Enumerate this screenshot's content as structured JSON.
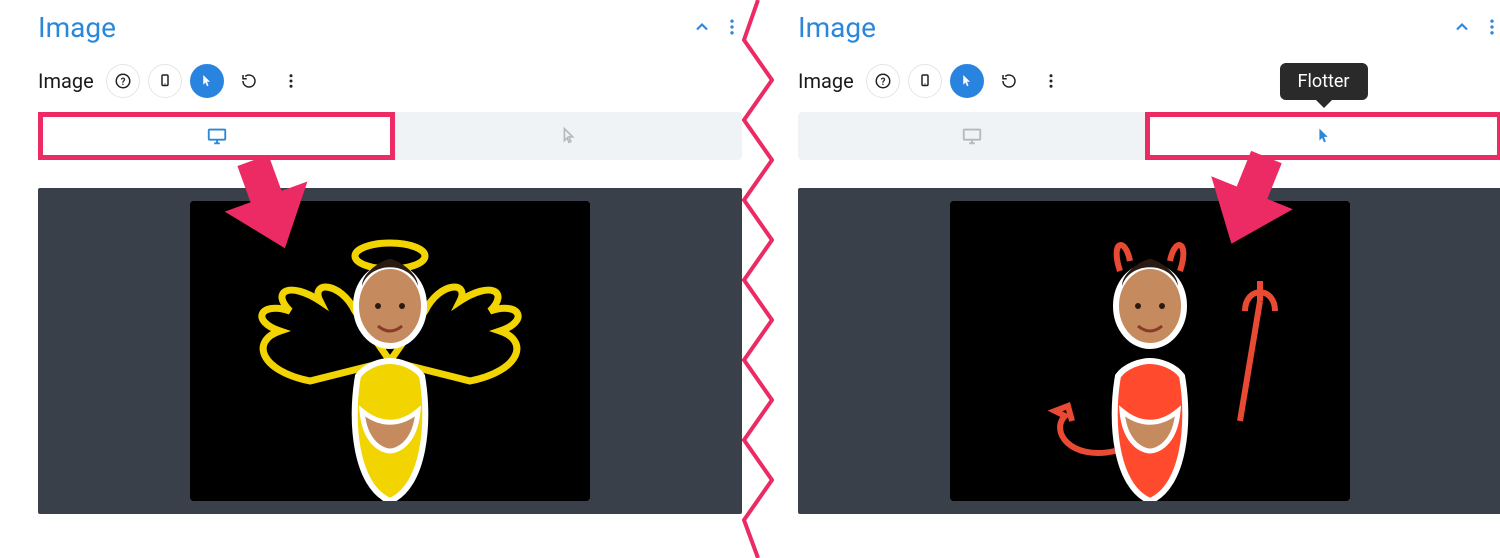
{
  "left": {
    "header_title": "Image",
    "toolbar_label": "Image",
    "tabs": {
      "desktop_state": "active",
      "hover_state": "inactive"
    },
    "preview_variant": "angel"
  },
  "right": {
    "header_title": "Image",
    "toolbar_label": "Image",
    "tabs": {
      "desktop_state": "inactive",
      "hover_state": "active"
    },
    "hover_tooltip": "Flotter",
    "preview_variant": "devil"
  },
  "icons": {
    "help": "help-icon",
    "phone": "phone-icon",
    "cursor": "cursor-icon",
    "reset": "reset-icon",
    "more": "more-icon",
    "chevron_up": "chevron-up-icon",
    "desktop": "desktop-icon",
    "hover_cursor": "hover-cursor-icon"
  },
  "annotation_color": "#ec2a64"
}
